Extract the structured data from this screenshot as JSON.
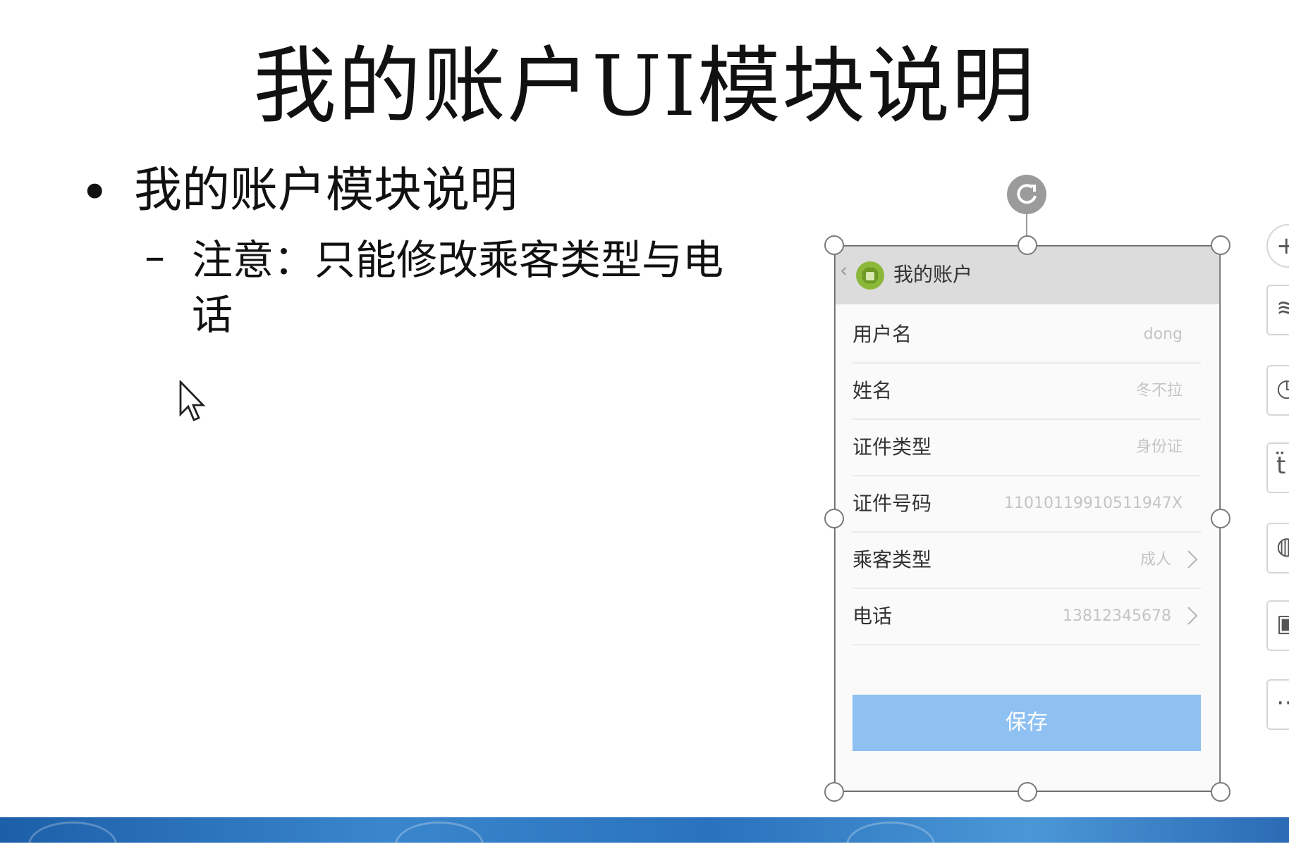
{
  "slide": {
    "title": "我的账户UI模块说明",
    "bullet": "我的账户模块说明",
    "sub_bullet": "注意：只能修改乘客类型与电话",
    "bullet_marker": "•",
    "dash_marker": "–"
  },
  "phone": {
    "title": "我的账户",
    "back_glyph": "‹",
    "rows": [
      {
        "label": "用户名",
        "value": "dong"
      },
      {
        "label": "姓名",
        "value": "冬不拉"
      },
      {
        "label": "证件类型",
        "value": "身份证"
      },
      {
        "label": "证件号码",
        "value": "11010119910511947X"
      },
      {
        "label": "乘客类型",
        "value": "成人"
      },
      {
        "label": "电话",
        "value": "13812345678"
      }
    ],
    "save_label": "保存",
    "accent_color": "#8ec0f2"
  },
  "icons": [
    "rotate-handle-icon",
    "android-app-icon",
    "chevron-right-icon",
    "mouse-cursor-icon"
  ],
  "side_toolbar": {
    "glyphs": [
      "+",
      "≋",
      "◷",
      "ẗ",
      "◍",
      "▣",
      "⋯"
    ]
  }
}
